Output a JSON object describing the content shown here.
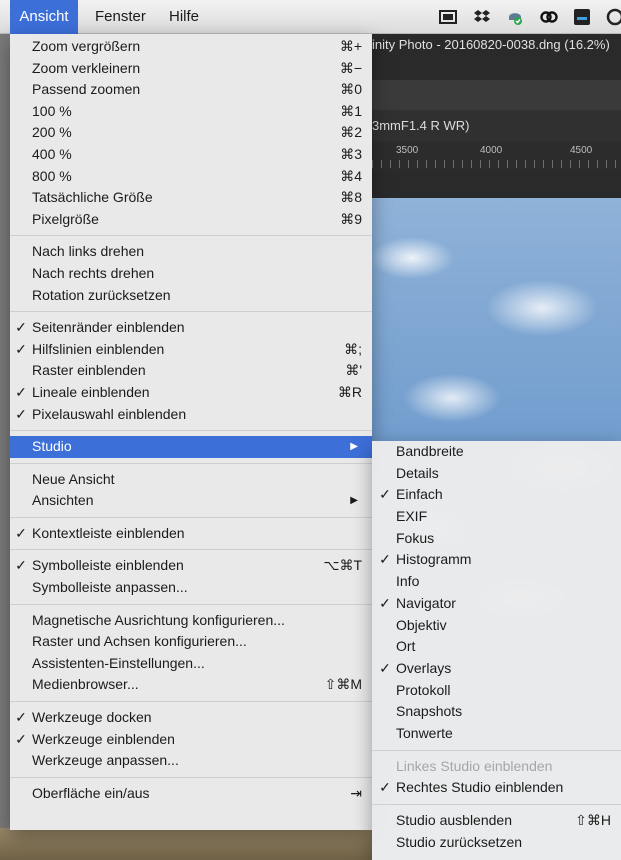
{
  "menubar": {
    "items": [
      "Ansicht",
      "Fenster",
      "Hilfe"
    ]
  },
  "document": {
    "title_fragment": "inity Photo - 20160820-0038.dng (16.2%)",
    "lens_fragment": "3mmF1.4 R WR)",
    "ruler_labels": [
      "3500",
      "4000",
      "4500"
    ]
  },
  "ansicht_menu": {
    "groups": [
      [
        {
          "label": "Zoom vergrößern",
          "shortcut": "⌘+"
        },
        {
          "label": "Zoom verkleinern",
          "shortcut": "⌘−"
        },
        {
          "label": "Passend zoomen",
          "shortcut": "⌘0"
        },
        {
          "label": "100 %",
          "shortcut": "⌘1"
        },
        {
          "label": "200 %",
          "shortcut": "⌘2"
        },
        {
          "label": "400 %",
          "shortcut": "⌘3"
        },
        {
          "label": "800 %",
          "shortcut": "⌘4"
        },
        {
          "label": "Tatsächliche Größe",
          "shortcut": "⌘8"
        },
        {
          "label": "Pixelgröße",
          "shortcut": "⌘9"
        }
      ],
      [
        {
          "label": "Nach links drehen"
        },
        {
          "label": "Nach rechts drehen"
        },
        {
          "label": "Rotation zurücksetzen"
        }
      ],
      [
        {
          "label": "Seitenränder einblenden",
          "checked": true
        },
        {
          "label": "Hilfslinien einblenden",
          "checked": true,
          "shortcut": "⌘;"
        },
        {
          "label": "Raster einblenden",
          "shortcut": "⌘'"
        },
        {
          "label": "Lineale einblenden",
          "checked": true,
          "shortcut": "⌘R"
        },
        {
          "label": "Pixelauswahl einblenden",
          "checked": true
        }
      ],
      [
        {
          "label": "Studio",
          "submenu": true,
          "highlighted": true
        }
      ],
      [
        {
          "label": "Neue Ansicht"
        },
        {
          "label": "Ansichten",
          "submenu": true
        }
      ],
      [
        {
          "label": "Kontextleiste einblenden",
          "checked": true
        }
      ],
      [
        {
          "label": "Symbolleiste einblenden",
          "checked": true,
          "shortcut": "⌥⌘T"
        },
        {
          "label": "Symbolleiste anpassen..."
        }
      ],
      [
        {
          "label": "Magnetische Ausrichtung konfigurieren..."
        },
        {
          "label": "Raster und Achsen konfigurieren..."
        },
        {
          "label": "Assistenten-Einstellungen..."
        },
        {
          "label": "Medienbrowser...",
          "shortcut": "⇧⌘M"
        }
      ],
      [
        {
          "label": "Werkzeuge docken",
          "checked": true
        },
        {
          "label": "Werkzeuge einblenden",
          "checked": true
        },
        {
          "label": "Werkzeuge anpassen..."
        }
      ],
      [
        {
          "label": "Oberfläche ein/aus",
          "shortcut": "⇥"
        }
      ]
    ]
  },
  "studio_menu": {
    "groups": [
      [
        {
          "label": "Bandbreite"
        },
        {
          "label": "Details"
        },
        {
          "label": "Einfach",
          "checked": true
        },
        {
          "label": "EXIF"
        },
        {
          "label": "Fokus"
        },
        {
          "label": "Histogramm",
          "checked": true
        },
        {
          "label": "Info"
        },
        {
          "label": "Navigator",
          "checked": true
        },
        {
          "label": "Objektiv"
        },
        {
          "label": "Ort"
        },
        {
          "label": "Overlays",
          "checked": true
        },
        {
          "label": "Protokoll"
        },
        {
          "label": "Snapshots"
        },
        {
          "label": "Tonwerte"
        }
      ],
      [
        {
          "label": "Linkes Studio einblenden",
          "disabled": true
        },
        {
          "label": "Rechtes Studio einblenden",
          "checked": true
        }
      ],
      [
        {
          "label": "Studio ausblenden",
          "shortcut": "⇧⌘H"
        },
        {
          "label": "Studio zurücksetzen"
        }
      ]
    ]
  },
  "colors": {
    "highlight": "#3d6fd9",
    "menu_bg": "#ececec",
    "disabled_text": "#a6a6a6"
  }
}
